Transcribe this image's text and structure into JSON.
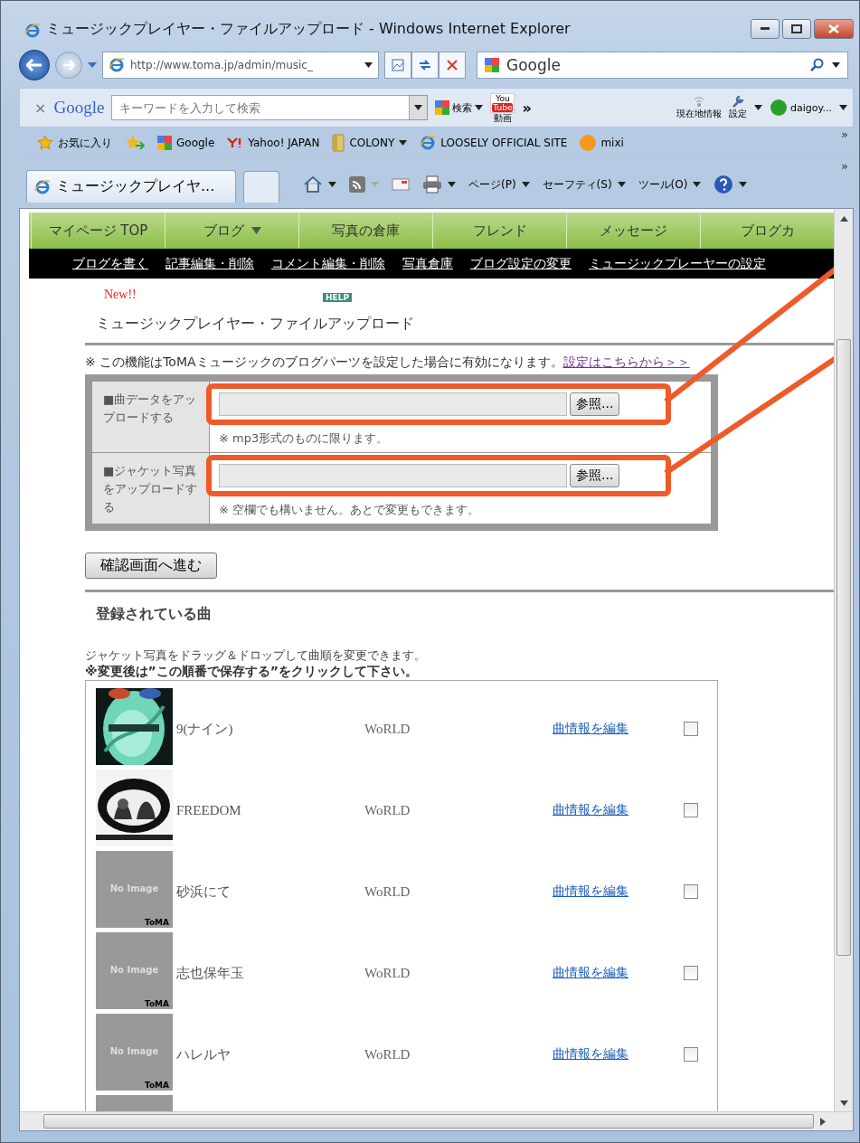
{
  "window": {
    "title": "ミュージックプレイヤー・ファイルアップロード - Windows Internet Explorer"
  },
  "address_bar": {
    "url": "http://www.toma.jp/admin/music_"
  },
  "search_box": {
    "provider": "Google"
  },
  "google_toolbar": {
    "close": "×",
    "logo": "Google",
    "placeholder": "キーワードを入力して検索",
    "search_button": "検索",
    "youtube": {
      "top": "You",
      "badge": "Tube",
      "label": "動画"
    },
    "more": "»",
    "location": "現在地情報",
    "settings": "設定",
    "user": "daigoy..."
  },
  "favorites_bar": {
    "favorites": "お気に入り",
    "items": [
      {
        "kind": "google",
        "label": "Google"
      },
      {
        "kind": "yahoo",
        "label": "Yahoo! JAPAN"
      },
      {
        "kind": "folder",
        "label": "COLONY"
      },
      {
        "kind": "page",
        "label": "LOOSELY OFFICIAL SITE"
      },
      {
        "kind": "mixi",
        "label": "mixi"
      }
    ],
    "more": "»"
  },
  "tabs": [
    {
      "label": "ミュージックプレイヤ...",
      "selected": true
    }
  ],
  "command_bar": {
    "menus": [
      "ページ(P)",
      "セーフティ(S)",
      "ツール(O)"
    ],
    "more": "»"
  },
  "site_nav": [
    {
      "label": "マイページ TOP",
      "dropdown": false
    },
    {
      "label": "ブログ",
      "dropdown": true
    },
    {
      "label": "写真の倉庫",
      "dropdown": false
    },
    {
      "label": "フレンド",
      "dropdown": false
    },
    {
      "label": "メッセージ",
      "dropdown": false
    },
    {
      "label": "ブログカ",
      "dropdown": false
    }
  ],
  "sub_nav": [
    "ブログを書く",
    "記事編集・削除",
    "コメント編集・削除",
    "写真倉庫",
    "ブログ設定の変更",
    "ミュージックプレーヤーの設定"
  ],
  "new_badge": "New!!",
  "help_badge": "HELP",
  "heading": "ミュージックプレイヤー・ファイルアップロード",
  "note": {
    "text": "※  この機能はToMAミュージックのブログパーツを設定した場合に有効になります。",
    "link": "設定はこちらから＞＞"
  },
  "upload_form": {
    "rows": [
      {
        "label": "■曲データをアップロードする",
        "hint": "※ mp3形式のものに限ります。",
        "browse": "参照..."
      },
      {
        "label": "■ジャケット写真をアップロードする",
        "hint": "※ 空欄でも構いません。あとで変更もできます。",
        "browse": "参照..."
      }
    ],
    "submit": "確認画面へ進む"
  },
  "songs_heading": "登録されている曲",
  "songs_instruction": "ジャケット写真をドラッグ＆ドロップして曲順を変更できます。",
  "songs_notice": "※変更後は”この順番で保存する”をクリックして下さい。",
  "songs": [
    {
      "kind": "picture",
      "title": "9(ナイン)",
      "artist": "WoRLD",
      "edit": "曲情報を編集",
      "checked": false
    },
    {
      "kind": "picture",
      "title": "FREEDOM",
      "artist": "WoRLD",
      "edit": "曲情報を編集",
      "checked": false
    },
    {
      "kind": "placeholder",
      "image_text": "No Image",
      "brand": "ToMA",
      "title": "砂浜にて",
      "artist": "WoRLD",
      "edit": "曲情報を編集",
      "checked": false
    },
    {
      "kind": "placeholder",
      "image_text": "No Image",
      "brand": "ToMA",
      "title": "志也保年玉",
      "artist": "WoRLD",
      "edit": "曲情報を編集",
      "checked": false
    },
    {
      "kind": "placeholder",
      "image_text": "No Image",
      "brand": "ToMA",
      "title": "ハレルヤ",
      "artist": "WoRLD",
      "edit": "曲情報を編集",
      "checked": false
    },
    {
      "kind": "placeholder"
    }
  ]
}
